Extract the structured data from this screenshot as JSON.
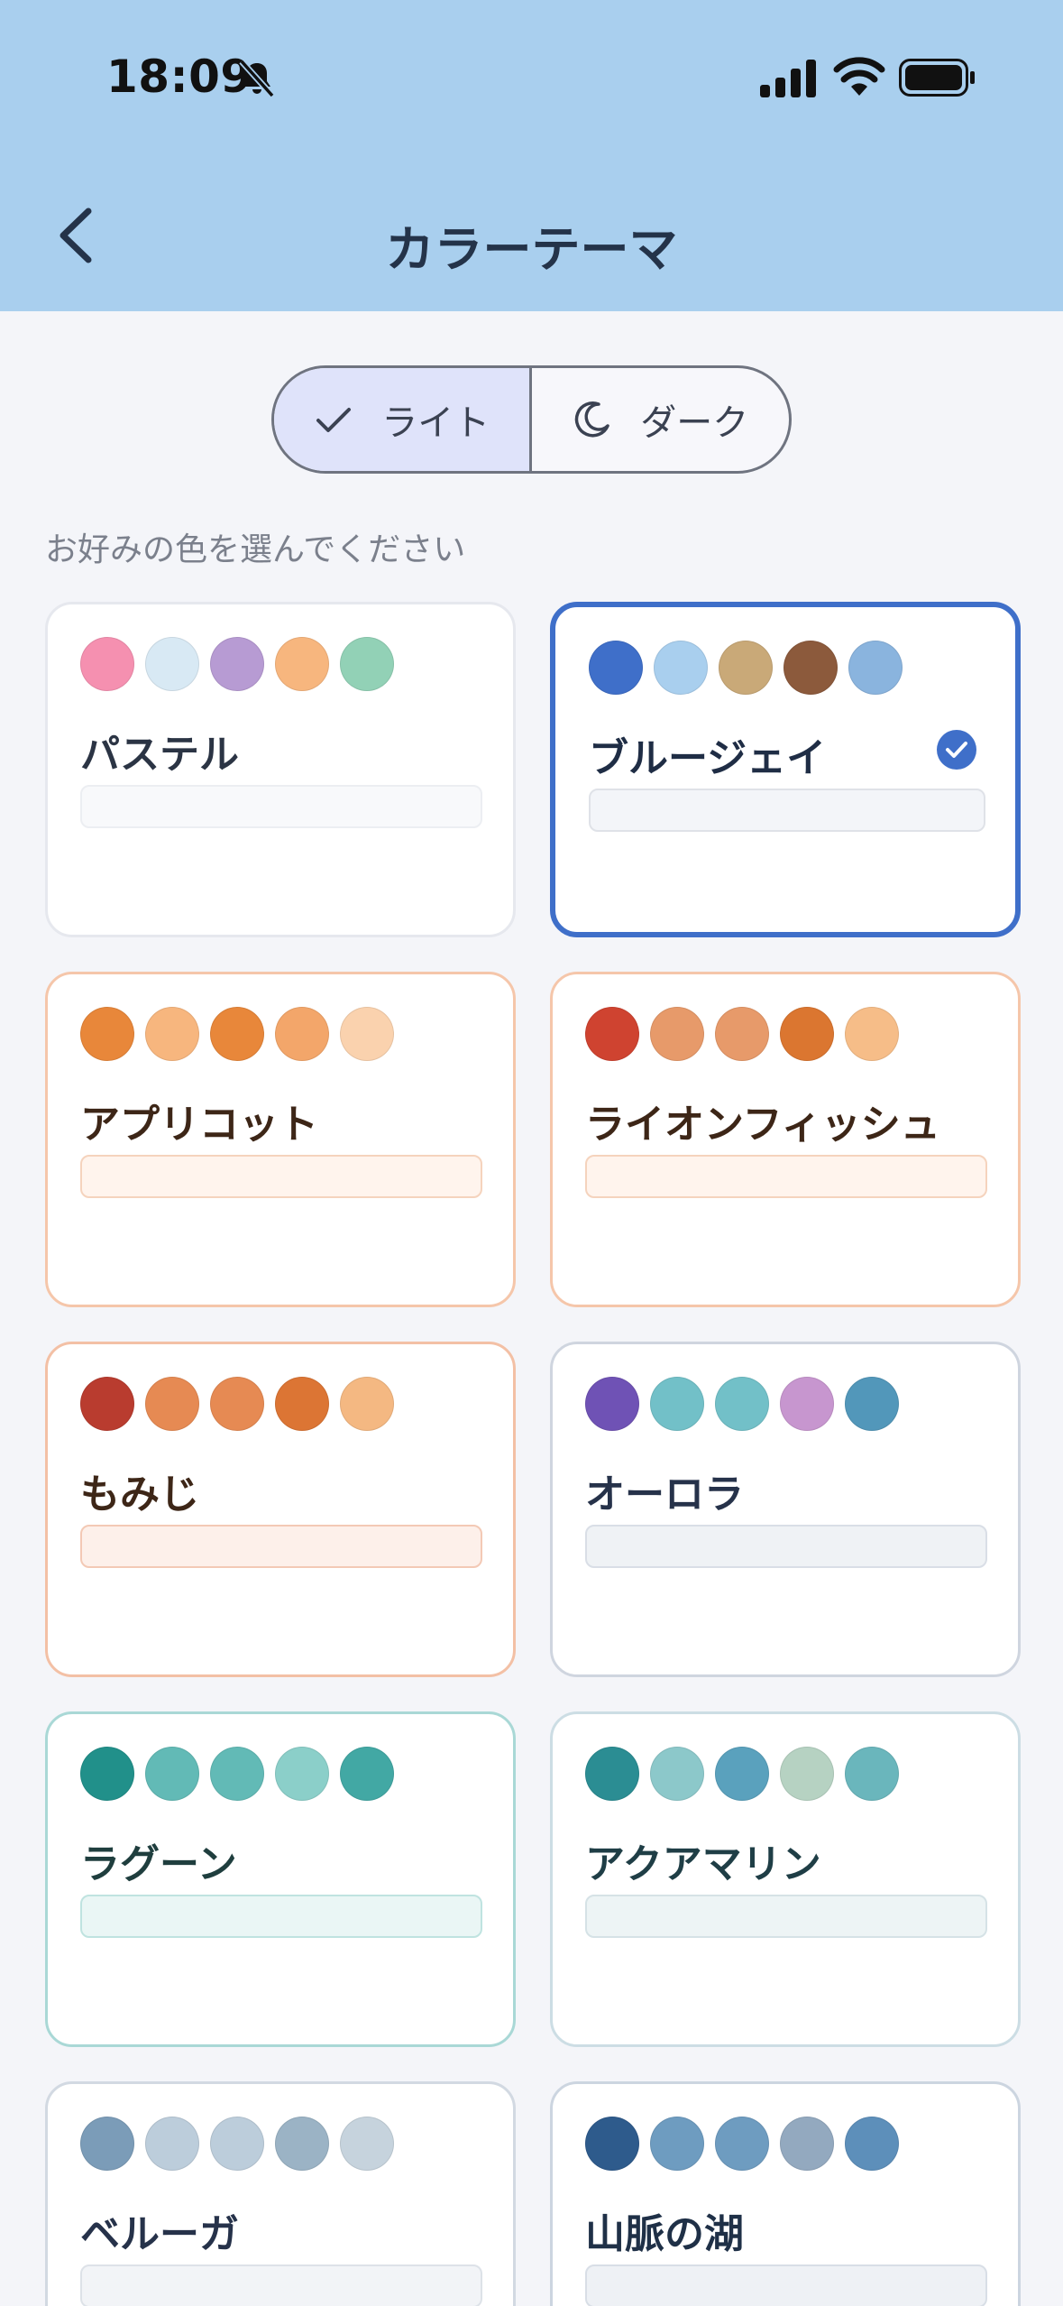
{
  "status": {
    "time": "18:09"
  },
  "header": {
    "title": "カラーテーマ"
  },
  "mode_toggle": {
    "light_label": "ライト",
    "dark_label": "ダーク",
    "selected": "light"
  },
  "subtitle": "お好みの色を選んでください",
  "themes": [
    {
      "name": "パステル",
      "selected": false,
      "border": "#e6e8ee",
      "text": "#2b3444",
      "bar_bg": "#f8f9fb",
      "bar_border": "#eceef2",
      "colors": [
        "#f590b0",
        "#d8e9f4",
        "#b79bd3",
        "#f7b67e",
        "#92d1b6"
      ]
    },
    {
      "name": "ブルージェイ",
      "selected": true,
      "border": "#3f6fc9",
      "text": "#1f2d45",
      "bar_bg": "#f3f5f9",
      "bar_border": "#dfe2e8",
      "colors": [
        "#3f6fc9",
        "#a9cfee",
        "#c9a978",
        "#8c5a3c",
        "#8ab4de"
      ]
    },
    {
      "name": "アプリコット",
      "selected": false,
      "border": "#f5c6aa",
      "text": "#3d2617",
      "bar_bg": "#fff4ed",
      "bar_border": "#f5d3bd",
      "colors": [
        "#e8873a",
        "#f7b67e",
        "#e8873a",
        "#f3a66a",
        "#fad2ae"
      ]
    },
    {
      "name": "ライオンフィッシュ",
      "selected": false,
      "border": "#f5c6aa",
      "text": "#3d2617",
      "bar_bg": "#fff4ed",
      "bar_border": "#f5d3bd",
      "colors": [
        "#cf4330",
        "#e79a6a",
        "#e79a6a",
        "#db7630",
        "#f6bd88"
      ]
    },
    {
      "name": "もみじ",
      "selected": false,
      "border": "#f3c0a5",
      "text": "#3d2617",
      "bar_bg": "#fdf0ea",
      "bar_border": "#f3c9b5",
      "colors": [
        "#b93c2f",
        "#e68a53",
        "#e68a53",
        "#dc7534",
        "#f4b882"
      ]
    },
    {
      "name": "オーロラ",
      "selected": false,
      "border": "#cfd5df",
      "text": "#26324a",
      "bar_bg": "#eff2f5",
      "bar_border": "#d9dee6",
      "colors": [
        "#6f52b5",
        "#72c0c8",
        "#72c0c8",
        "#c796cf",
        "#5297ba"
      ]
    },
    {
      "name": "ラグーン",
      "selected": false,
      "border": "#a9d8d6",
      "text": "#1f3e3e",
      "bar_bg": "#eaf6f5",
      "bar_border": "#bfe3e0",
      "colors": [
        "#21908a",
        "#62bab6",
        "#62bab6",
        "#8bcfc9",
        "#42a8a4"
      ]
    },
    {
      "name": "アクアマリン",
      "selected": false,
      "border": "#ccdde4",
      "text": "#1f3e46",
      "bar_bg": "#edf4f5",
      "bar_border": "#d5e2e6",
      "colors": [
        "#2b8d93",
        "#8cc8ca",
        "#5aa1bd",
        "#b6d2c2",
        "#6ab6bc"
      ]
    },
    {
      "name": "ベルーガ",
      "selected": false,
      "border": "#d2d9e2",
      "text": "#26324a",
      "bar_bg": "#f2f4f7",
      "bar_border": "#dde2e8",
      "colors": [
        "#7b9cb8",
        "#bccddb",
        "#bccddb",
        "#9bb3c5",
        "#c6d3dd"
      ]
    },
    {
      "name": "山脈の湖",
      "selected": false,
      "border": "#ccd5e0",
      "text": "#1f3047",
      "bar_bg": "#eef1f5",
      "bar_border": "#d8dee6",
      "colors": [
        "#2e5b8c",
        "#6e9cc0",
        "#6e9cc0",
        "#93a9bf",
        "#5d8fba"
      ]
    }
  ]
}
